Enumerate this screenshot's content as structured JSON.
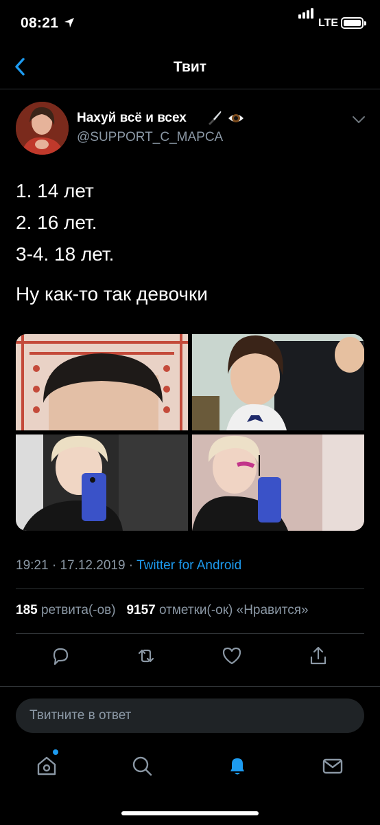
{
  "status_bar": {
    "time": "08:21",
    "network": "LTE"
  },
  "nav": {
    "title": "Твит"
  },
  "tweet": {
    "display_name": "Нахуй всё и всех",
    "handle": "@SUPPORT_C_MAPCA",
    "lines": [
      "1. 14 лет",
      "2. 16 лет.",
      "3-4. 18 лет."
    ],
    "caption": "Ну как-то так девочки",
    "time": "19:21",
    "date": "17.12.2019",
    "separator": " · ",
    "source": "Twitter for Android",
    "retweets_count": "185",
    "retweets_label": "ретвита(-ов)",
    "likes_count": "9157",
    "likes_label": "отметки(-ок) «Нравится»"
  },
  "reply": {
    "placeholder": "Твитните в ответ"
  },
  "colors": {
    "accent": "#1d9bf0",
    "muted": "#8b98a5",
    "divider": "#2f3336"
  },
  "icons": [
    "back-chevron-icon",
    "knife-emoji-icon",
    "eye-emoji-icon",
    "chevron-down-icon",
    "reply-icon",
    "retweet-icon",
    "like-icon",
    "share-icon",
    "home-icon",
    "search-icon",
    "notifications-icon",
    "messages-icon"
  ]
}
